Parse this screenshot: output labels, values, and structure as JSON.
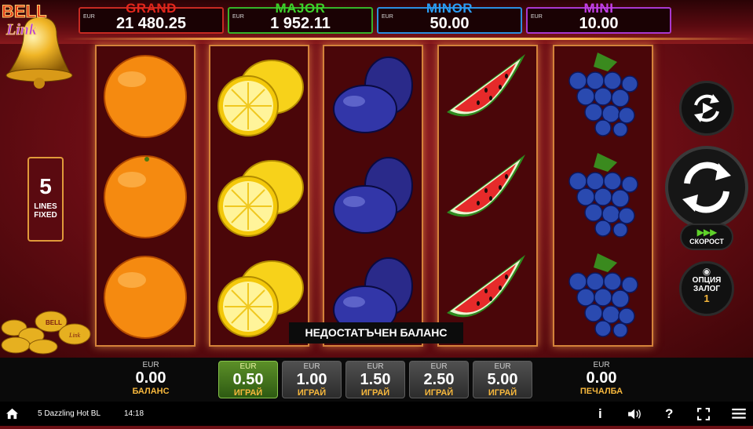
{
  "jackpots": [
    {
      "name": "GRAND",
      "currency": "EUR",
      "value": "21 480.25",
      "color": "#e2261b"
    },
    {
      "name": "MAJOR",
      "currency": "EUR",
      "value": "1 952.11",
      "color": "#3cd12a"
    },
    {
      "name": "MINOR",
      "currency": "EUR",
      "value": "50.00",
      "color": "#2a9df4"
    },
    {
      "name": "MINI",
      "currency": "EUR",
      "value": "10.00",
      "color": "#c440e8"
    }
  ],
  "logo": {
    "line1": "BELL",
    "line2": "Link"
  },
  "lines": {
    "count": "5",
    "label1": "LINES",
    "label2": "FIXED"
  },
  "reels": [
    {
      "symbol": "orange",
      "icon": "orange-icon"
    },
    {
      "symbol": "lemon",
      "icon": "lemon-icon"
    },
    {
      "symbol": "plum",
      "icon": "plum-icon"
    },
    {
      "symbol": "watermelon",
      "icon": "watermelon-icon"
    },
    {
      "symbol": "grapes",
      "icon": "grapes-icon"
    }
  ],
  "controls": {
    "speed_label": "СКОРОСТ",
    "bet_option_line1": "ОПЦИЯ",
    "bet_option_line2": "ЗАЛОГ",
    "bet_option_value": "1"
  },
  "message": "НЕДОСТАТЪЧЕН БАЛАНС",
  "balance": {
    "currency": "EUR",
    "value": "0.00",
    "label": "БАЛАНС"
  },
  "win": {
    "currency": "EUR",
    "value": "0.00",
    "label": "ПЕЧАЛБА"
  },
  "bets": [
    {
      "currency": "EUR",
      "value": "0.50",
      "label": "ИГРАЙ",
      "selected": true
    },
    {
      "currency": "EUR",
      "value": "1.00",
      "label": "ИГРАЙ",
      "selected": false
    },
    {
      "currency": "EUR",
      "value": "1.50",
      "label": "ИГРАЙ",
      "selected": false
    },
    {
      "currency": "EUR",
      "value": "2.50",
      "label": "ИГРАЙ",
      "selected": false
    },
    {
      "currency": "EUR",
      "value": "5.00",
      "label": "ИГРАЙ",
      "selected": false
    }
  ],
  "statusbar": {
    "game_title": "5 Dazzling Hot BL",
    "time": "14:18",
    "info": "i",
    "help": "?"
  }
}
